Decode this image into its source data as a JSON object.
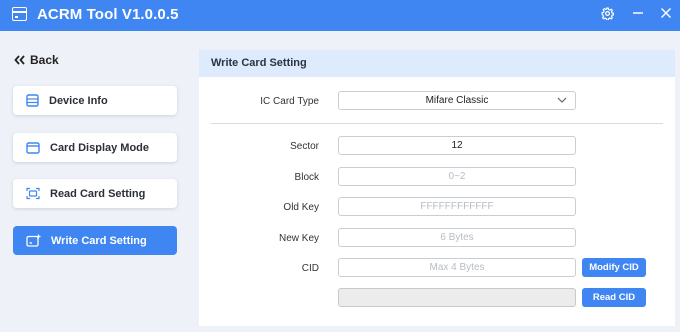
{
  "app": {
    "title": "ACRM Tool V1.0.0.5"
  },
  "window_controls": {
    "settings_icon": "gear-icon",
    "minimize_icon": "minimize-icon",
    "close_icon": "close-icon"
  },
  "sidebar": {
    "back_label": "Back",
    "items": [
      {
        "label": "Device Info",
        "icon": "device-info-icon",
        "active": false
      },
      {
        "label": "Card Display Mode",
        "icon": "card-icon",
        "active": false
      },
      {
        "label": "Read Card Setting",
        "icon": "read-card-icon",
        "active": false
      },
      {
        "label": "Write Card Setting",
        "icon": "write-card-icon",
        "active": true
      }
    ]
  },
  "panel": {
    "title": "Write Card Setting",
    "ic_card_type": {
      "label": "IC Card Type",
      "value": "Mifare Classic"
    },
    "sector": {
      "label": "Sector",
      "value": "12"
    },
    "block": {
      "label": "Block",
      "placeholder": "0~2"
    },
    "old_key": {
      "label": "Old Key",
      "placeholder": "FFFFFFFFFFFF"
    },
    "new_key": {
      "label": "New Key",
      "placeholder": "6 Bytes"
    },
    "cid": {
      "label": "CID",
      "placeholder": "Max 4 Bytes"
    },
    "cid_readout": {
      "value": ""
    },
    "modify_cid_label": "Modify CID",
    "read_cid_label": "Read CID"
  },
  "colors": {
    "accent": "#3f86f3",
    "panel_header": "#ddebfc",
    "background": "#eef1f7"
  }
}
